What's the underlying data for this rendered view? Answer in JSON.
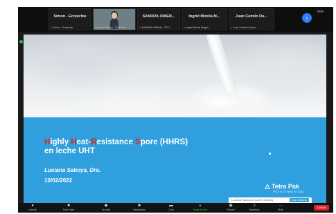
{
  "participants": [
    {
      "name": "Simon - Ecolechie",
      "sub": "Simon - Ecolechie",
      "video": false
    },
    {
      "name": "",
      "sub": "Luciana Saboya - Tetra Pak",
      "video": true
    },
    {
      "name": "SANDRA XIMEN...",
      "sub": "SANDRA XIMENA - TSTI",
      "video": false
    },
    {
      "name": "Ingrid Mirella M...",
      "sub": "Ingrid Mirella Mogoll...",
      "video": false
    },
    {
      "name": "Juan Camilo Du...",
      "sub": "Juan Camilo Duchar...",
      "video": false
    }
  ],
  "strip": {
    "view_label": "View"
  },
  "slide": {
    "title_line1_parts": [
      {
        "text": "H",
        "red": true
      },
      {
        "text": "ighly ",
        "red": false
      },
      {
        "text": "H",
        "red": true
      },
      {
        "text": "eat-",
        "red": false
      },
      {
        "text": "R",
        "red": true
      },
      {
        "text": "esistance ",
        "red": false
      },
      {
        "text": "S",
        "red": true
      },
      {
        "text": "pore  (HHRS)",
        "red": false
      }
    ],
    "title_line2": "en leche UHT",
    "author": "Luciana Saboya, Dra.",
    "date": "10/02/2022",
    "logo_text": "Tetra Pak",
    "logo_tagline": "PROTECTS WHAT'S GOOD",
    "share_text": "Luciana Saboya is screen sharing",
    "share_button": "Stop sharing"
  },
  "toolbar": {
    "items": [
      {
        "label": "Unmute",
        "icon": "microphone-icon"
      },
      {
        "label": "Start Video",
        "icon": "video-camera-icon"
      },
      {
        "label": "Security",
        "icon": "shield-icon"
      },
      {
        "label": "Participants",
        "icon": "participants-icon"
      },
      {
        "label": "Chat",
        "icon": "chat-icon"
      },
      {
        "label": "Share Screen",
        "icon": "share-screen-icon"
      },
      {
        "label": "Record",
        "icon": "record-icon"
      },
      {
        "label": "Reactions",
        "icon": "reactions-icon"
      },
      {
        "label": "More",
        "icon": "more-icon"
      }
    ],
    "leave_label": "Leave"
  },
  "colors": {
    "slide_blue": "#2f9fdd",
    "accent_red": "#d8261b",
    "share_green": "#22c55e",
    "leave_red": "#d8262c"
  }
}
